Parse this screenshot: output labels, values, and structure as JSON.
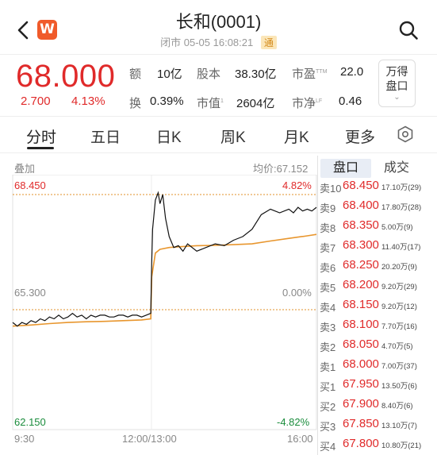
{
  "header": {
    "title": "长和(0001)",
    "status": "闭市",
    "datetime": "05-05 16:08:21",
    "badge": "通",
    "logo_letter": "W"
  },
  "quote": {
    "price": "68.000",
    "change": "2.700",
    "change_pct": "4.13%",
    "stats": [
      {
        "label": "额",
        "sup": "",
        "value": "10亿"
      },
      {
        "label": "股本",
        "sup": "",
        "value": "38.30亿"
      },
      {
        "label": "市盈",
        "sup": "TTM",
        "value": "22.0"
      },
      {
        "label": "换",
        "sup": "",
        "value": "0.39%"
      },
      {
        "label": "市值",
        "sup": "1",
        "value": "2604亿"
      },
      {
        "label": "市净",
        "sup": "LF",
        "value": "0.46"
      }
    ],
    "wande_line1": "万得",
    "wande_line2": "盘口",
    "wande_chevron": "⌄"
  },
  "tabs": [
    {
      "label": "分时",
      "active": true
    },
    {
      "label": "五日",
      "active": false
    },
    {
      "label": "日K",
      "active": false
    },
    {
      "label": "周K",
      "active": false
    },
    {
      "label": "月K",
      "active": false
    },
    {
      "label": "更多",
      "active": false
    }
  ],
  "chart": {
    "overlay_label": "叠加",
    "avg_label": "均价:67.152",
    "y_top": "68.450",
    "y_mid": "65.300",
    "y_bottom": "62.150",
    "pct_top": "4.82%",
    "pct_mid": "0.00%",
    "pct_bottom": "-4.82%",
    "time_start": "9:30",
    "time_mid": "12:00/13:00",
    "time_end": "16:00",
    "colors": {
      "price_line": "#111111",
      "avg_line": "#e8962e",
      "up": "#e02a2a",
      "down": "#1a8c3c",
      "ref_line": "#e0902a"
    }
  },
  "chart_data": {
    "type": "line",
    "ylim": [
      62.15,
      68.45
    ],
    "ref_price": 65.3,
    "series": [
      {
        "name": "",
        "x": [
          0,
          5,
          10,
          15,
          20,
          25,
          30,
          35,
          40,
          45,
          50,
          55,
          60,
          65,
          70,
          75,
          80,
          85,
          90,
          95,
          100,
          105,
          110,
          115,
          120,
          125,
          130,
          135,
          140,
          145,
          150,
          151,
          152,
          155,
          158,
          160,
          163,
          166,
          170,
          175,
          180,
          185,
          190,
          200,
          210,
          220,
          230,
          240,
          250,
          260,
          270,
          280,
          290,
          300,
          305,
          310,
          315,
          320,
          325,
          330
        ],
        "values": [
          64.95,
          64.85,
          64.95,
          64.9,
          65.0,
          64.95,
          65.05,
          65.0,
          65.1,
          65.05,
          65.15,
          65.05,
          65.1,
          65.2,
          65.1,
          65.15,
          65.05,
          65.15,
          65.1,
          65.15,
          65.15,
          65.1,
          65.1,
          65.15,
          65.15,
          65.1,
          65.15,
          65.15,
          65.1,
          65.15,
          65.2,
          66.6,
          67.5,
          68.3,
          68.5,
          68.2,
          68.45,
          67.8,
          67.3,
          67.0,
          67.05,
          66.9,
          67.1,
          66.9,
          67.0,
          67.1,
          67.05,
          67.2,
          67.3,
          67.5,
          67.9,
          68.05,
          67.95,
          68.05,
          67.95,
          68.1,
          68.0,
          68.05,
          68.0,
          68.1
        ]
      },
      {
        "name": "",
        "x": [
          0,
          20,
          40,
          60,
          80,
          100,
          120,
          140,
          150,
          151,
          155,
          160,
          170,
          180,
          200,
          220,
          240,
          260,
          280,
          300,
          320,
          330
        ],
        "values": [
          64.85,
          64.88,
          64.92,
          64.95,
          64.97,
          64.98,
          65.0,
          65.02,
          65.05,
          66.2,
          66.85,
          66.95,
          67.0,
          67.02,
          67.05,
          67.06,
          67.08,
          67.1,
          67.18,
          67.25,
          67.32,
          67.36
        ]
      }
    ],
    "x_labels": [
      "9:30",
      "12:00/13:00",
      "16:00"
    ]
  },
  "orderbook": {
    "tab_active": "盘口",
    "tab_inactive": "成交",
    "rows": [
      {
        "label": "卖10",
        "price": "68.450",
        "vol": "17.10万(29)",
        "color": "red"
      },
      {
        "label": "卖9",
        "price": "68.400",
        "vol": "17.80万(28)",
        "color": "red"
      },
      {
        "label": "卖8",
        "price": "68.350",
        "vol": "5.00万(9)",
        "color": "red"
      },
      {
        "label": "卖7",
        "price": "68.300",
        "vol": "11.40万(17)",
        "color": "red"
      },
      {
        "label": "卖6",
        "price": "68.250",
        "vol": "20.20万(9)",
        "color": "red"
      },
      {
        "label": "卖5",
        "price": "68.200",
        "vol": "9.20万(29)",
        "color": "red"
      },
      {
        "label": "卖4",
        "price": "68.150",
        "vol": "9.20万(12)",
        "color": "red"
      },
      {
        "label": "卖3",
        "price": "68.100",
        "vol": "7.70万(16)",
        "color": "red"
      },
      {
        "label": "卖2",
        "price": "68.050",
        "vol": "4.70万(5)",
        "color": "red"
      },
      {
        "label": "卖1",
        "price": "68.000",
        "vol": "7.00万(37)",
        "color": "red"
      },
      {
        "label": "买1",
        "price": "67.950",
        "vol": "13.50万(6)",
        "color": "red"
      },
      {
        "label": "买2",
        "price": "67.900",
        "vol": "8.40万(6)",
        "color": "red"
      },
      {
        "label": "买3",
        "price": "67.850",
        "vol": "13.10万(7)",
        "color": "red"
      },
      {
        "label": "买4",
        "price": "67.800",
        "vol": "10.80万(21)",
        "color": "red"
      }
    ]
  }
}
